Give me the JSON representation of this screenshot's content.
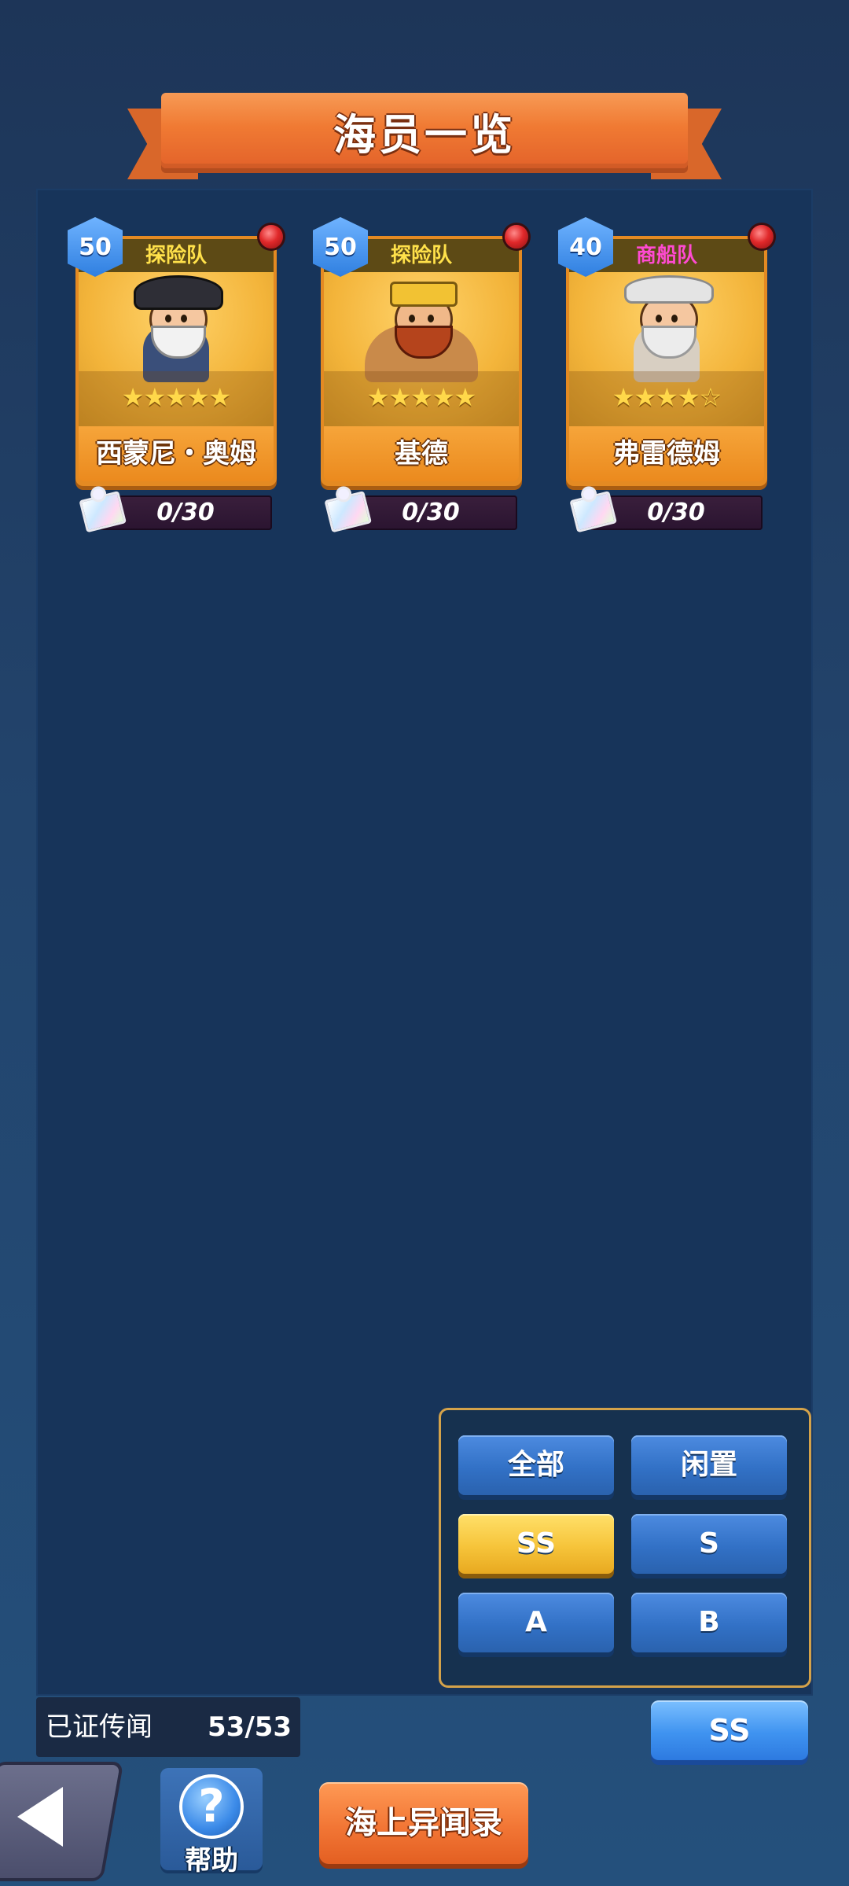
{
  "header": {
    "title": "海员一览"
  },
  "crew": [
    {
      "level": "50",
      "team": "探险队",
      "team_color": "#ffe14a",
      "name": "西蒙尼・奥姆",
      "stars": "★★★★★",
      "shards": "0/30"
    },
    {
      "level": "50",
      "team": "探险队",
      "team_color": "#ffe14a",
      "name": "基德",
      "stars": "★★★★★",
      "shards": "0/30"
    },
    {
      "level": "40",
      "team": "商船队",
      "team_color": "#ff4ad2",
      "name": "弗雷德姆",
      "stars": "★★★★☆",
      "shards": "0/30"
    }
  ],
  "filters": {
    "all": "全部",
    "idle": "闲置",
    "ss": "SS",
    "s": "S",
    "a": "A",
    "b": "B",
    "active": "SS"
  },
  "legend": {
    "label": "已证传闻",
    "count": "53/53"
  },
  "sort": {
    "label": "SS"
  },
  "nav": {
    "help_label": "帮助",
    "help_icon": "?",
    "log_label": "海上异闻录"
  }
}
